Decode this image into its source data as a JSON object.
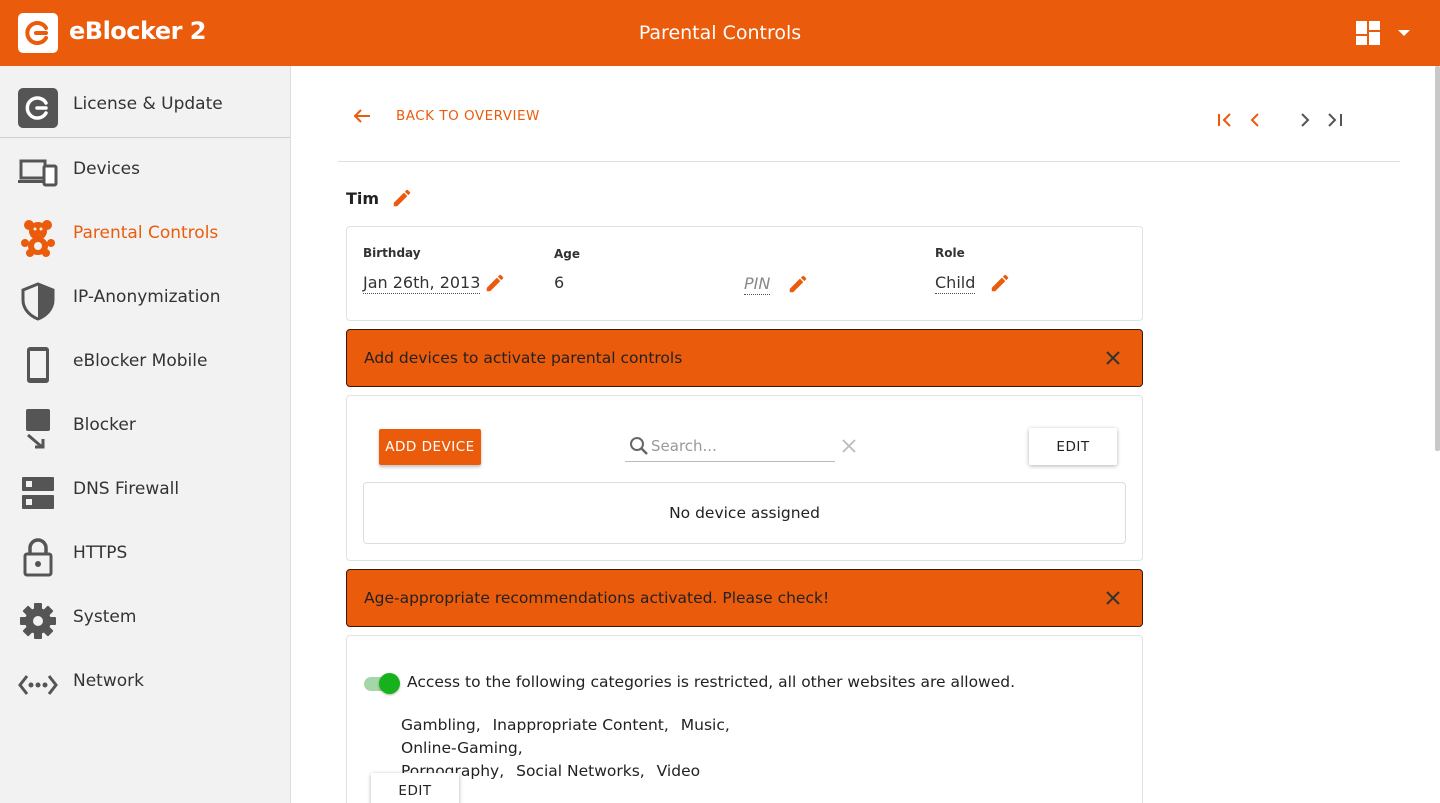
{
  "app": {
    "brand": "eBlocker 2",
    "page_title": "Parental Controls",
    "accent_color": "#eb5b0c"
  },
  "sidebar": {
    "items": [
      {
        "label": "License & Update",
        "icon": "refresh-icon"
      },
      {
        "label": "Devices",
        "icon": "devices-icon"
      },
      {
        "label": "Parental Controls",
        "icon": "teddy-bear-icon",
        "active": true
      },
      {
        "label": "IP-Anonymization",
        "icon": "shield-icon"
      },
      {
        "label": "eBlocker Mobile",
        "icon": "phone-icon"
      },
      {
        "label": "Blocker",
        "icon": "blocker-icon"
      },
      {
        "label": "DNS Firewall",
        "icon": "server-icon"
      },
      {
        "label": "HTTPS",
        "icon": "lock-icon"
      },
      {
        "label": "System",
        "icon": "gear-icon"
      },
      {
        "label": "Network",
        "icon": "network-icon"
      }
    ]
  },
  "nav": {
    "back_label": "BACK TO OVERVIEW"
  },
  "profile": {
    "name": "Tim",
    "birthday_label": "Birthday",
    "birthday_value": "Jan 26th, 2013",
    "age_label": "Age",
    "age_value": "6",
    "pin_value": "PIN",
    "role_label": "Role",
    "role_value": "Child"
  },
  "alerts": {
    "devices": "Add devices to activate parental controls",
    "recommendations": "Age-appropriate recommendations activated. Please check!"
  },
  "devices": {
    "add_button": "ADD DEVICE",
    "search_placeholder": "Search...",
    "edit_button": "EDIT",
    "empty_text": "No device assigned"
  },
  "restrictions": {
    "enabled": true,
    "description": "Access to the following categories is restricted, all other websites are allowed.",
    "categories_line1": [
      "Gambling,",
      "Inappropriate Content,",
      "Music,",
      "Online-Gaming,"
    ],
    "categories_line2": [
      "Pornography,",
      "Social Networks,",
      "Video"
    ],
    "edit_button": "EDIT"
  }
}
